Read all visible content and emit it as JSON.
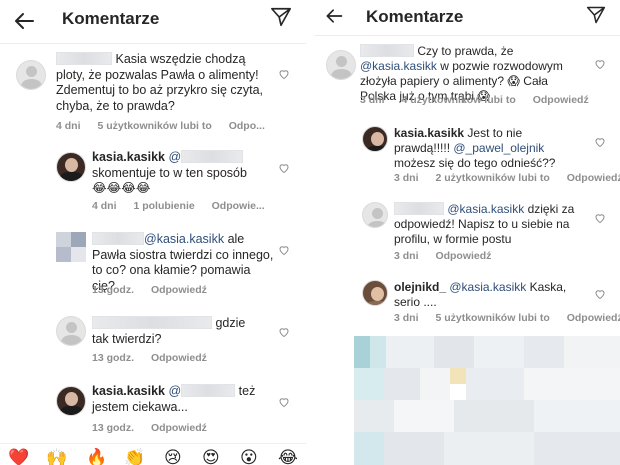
{
  "left": {
    "header": {
      "title": "Komentarze",
      "back_icon": "arrow-left-icon",
      "send_icon": "paper-plane-icon"
    },
    "comments": [
      {
        "text": "Kasia wszędzie chodzą ploty, że pozwalas Pawła o alimenty! Zdementuj to bo aż przykro się czyta, chyba, że to prawda?",
        "time": "4 dni",
        "likes": "5 użytkowników lubi to",
        "reply": "Odpo..."
      },
      {
        "username": "kasia.kasikk",
        "mention": "@",
        "text": "skomentuje to w ten sposób",
        "emojis": "😂😂😂😂",
        "time": "4 dni",
        "likes": "1 polubienie",
        "reply": "Odpowie..."
      },
      {
        "mention": "@kasia.kasikk",
        "text_a": "ale",
        "text_b": "Pawła siostra twierdzi co innego, to co? ona kłamie? pomawia cię?",
        "time": "13 godz.",
        "reply": "Odpowiedź"
      },
      {
        "text_a": "gdzie",
        "text_b": "tak twierdzi?",
        "time": "13 godz.",
        "reply": "Odpowiedź"
      },
      {
        "username": "kasia.kasikk",
        "mention": "@",
        "text_a": "też",
        "text_b": "jestem ciekawa...",
        "time": "13 godz.",
        "reply": "Odpowiedź"
      }
    ],
    "emoji_bar": [
      "❤️",
      "🙌",
      "🔥",
      "👏",
      "😢",
      "😍",
      "😮",
      "😂"
    ]
  },
  "right": {
    "header": {
      "title": "Komentarze",
      "back_icon": "arrow-left-icon",
      "send_icon": "paper-plane-icon"
    },
    "comments": [
      {
        "text_a": "Czy to prawda, że",
        "mention": "@kasia.kasikk",
        "text_b": "w pozwie rozwodowym złożyła papiery o alimenty?",
        "emoji_a": "😱",
        "text_c": "Cała Polska już o tym trąbi",
        "emoji_b": "😱",
        "time": "3 dni",
        "likes": "4 użytkowników lubi to",
        "reply": "Odpowiedź"
      },
      {
        "username": "kasia.kasikk",
        "text_a": "Jest to nie prawdą!!!!!",
        "mention": "@_pawel_olejnik",
        "text_b": "możesz się do tego odnieść??",
        "time": "3 dni",
        "likes": "2 użytkowników lubi to",
        "reply": "Odpowiedź"
      },
      {
        "mention": "@kasia.kasikk",
        "text_a": "dzięki za odpowiedź! Napisz to u siebie na profilu, w formie postu",
        "time": "3 dni",
        "reply": "Odpowiedź"
      },
      {
        "username": "olejnikd_",
        "mention": "@kasia.kasikk",
        "text_a": "Kaska, serio ....",
        "time": "3 dni",
        "likes": "5 użytkowników lubi to",
        "reply": "Odpowiedź"
      }
    ]
  }
}
